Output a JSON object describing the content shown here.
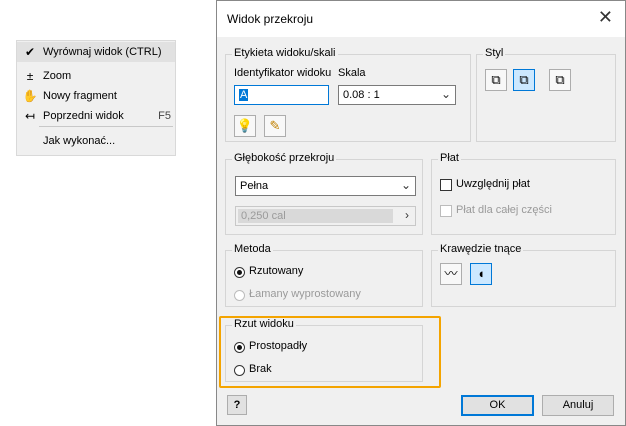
{
  "context_menu": {
    "items": [
      {
        "icon": "check-icon",
        "glyph": "✔",
        "label": "Wyrównaj widok (CTRL)",
        "shortcut": ""
      },
      {
        "icon": "zoom-icon",
        "glyph": "±",
        "label": "Zoom",
        "shortcut": ""
      },
      {
        "icon": "hand-icon",
        "glyph": "✋",
        "label": "Nowy fragment",
        "shortcut": ""
      },
      {
        "icon": "previous-view-icon",
        "glyph": "↤",
        "label": "Poprzedni widok",
        "shortcut": "F5"
      },
      {
        "icon": "",
        "glyph": "",
        "label": "Jak wykonać...",
        "shortcut": ""
      }
    ]
  },
  "dialog": {
    "title": "Widok przekroju",
    "close_glyph": "✕",
    "label_group": {
      "title": "Etykieta widoku/skali",
      "id_label": "Identyfikator widoku",
      "id_value": "A",
      "scale_label": "Skala",
      "scale_value": "0.08 : 1",
      "toggle_visibility_glyph": "💡",
      "edit_label_glyph": "✎"
    },
    "style_group": {
      "title": "Styl",
      "buttons": [
        {
          "name": "style-hidden-lines-button",
          "glyph": "⧉",
          "active": false
        },
        {
          "name": "style-hidden-lines-removed-button",
          "glyph": "⧉",
          "active": true
        },
        {
          "name": "style-shaded-button",
          "glyph": "⧉",
          "active": false
        }
      ]
    },
    "depth_group": {
      "title": "Głębokość przekroju",
      "value": "Pełna",
      "distance": "0,250 cal",
      "distance_caret": "›"
    },
    "slice_group": {
      "title": "Płat",
      "include_slice": "Uwzględnij płat",
      "slice_all": "Płat dla całej części"
    },
    "method_group": {
      "title": "Metoda",
      "projected": "Rzutowany",
      "aligned": "Łamany wyprostowany"
    },
    "cutting_edges_group": {
      "title": "Krawędzie tnące",
      "buttons": [
        {
          "name": "cutting-edge-smooth-button",
          "glyph": "〰",
          "active": false
        },
        {
          "name": "cutting-edge-sharp-button",
          "glyph": "◖",
          "active": true
        }
      ]
    },
    "projection_group": {
      "title": "Rzut widoku",
      "orthogonal": "Prostopadły",
      "none": "Brak"
    },
    "help_glyph": "?",
    "ok_label": "OK",
    "cancel_label": "Anuluj",
    "colors": {
      "accent": "#0078d7",
      "highlight": "#f4a400"
    }
  }
}
